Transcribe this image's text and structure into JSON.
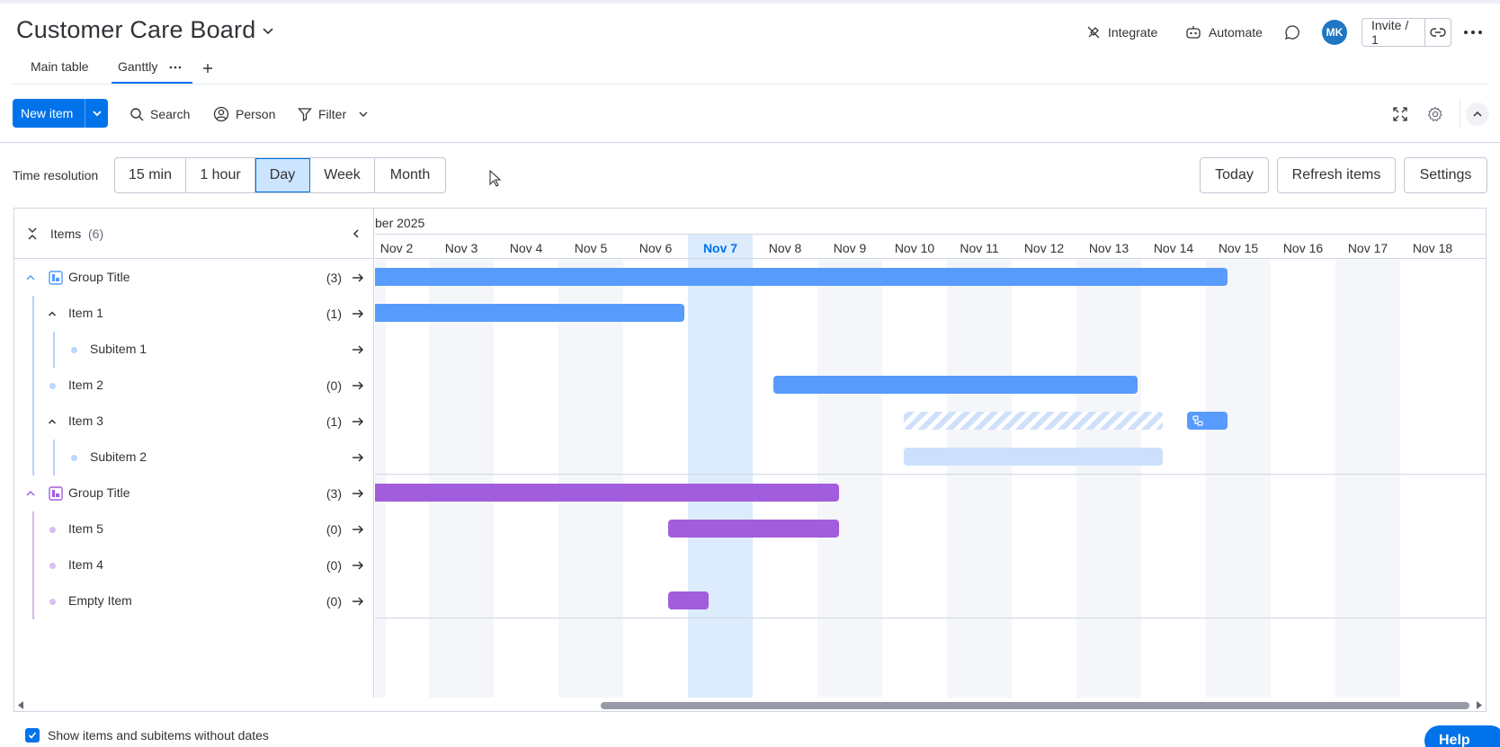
{
  "board": {
    "title": "Customer Care Board"
  },
  "header": {
    "integrate": "Integrate",
    "automate": "Automate",
    "avatar": "MK",
    "invite": "Invite / 1"
  },
  "tabs": [
    {
      "label": "Main table",
      "active": false
    },
    {
      "label": "Ganttly",
      "active": true
    }
  ],
  "toolbar": {
    "new_item": "New item",
    "search": "Search",
    "person": "Person",
    "filter": "Filter"
  },
  "time_resolution": {
    "label": "Time resolution",
    "options": [
      "15 min",
      "1 hour",
      "Day",
      "Week",
      "Month"
    ],
    "selected": "Day"
  },
  "actions": {
    "today": "Today",
    "refresh": "Refresh items",
    "settings": "Settings"
  },
  "items_header": {
    "label": "Items",
    "count": "(6)"
  },
  "rows": [
    {
      "label": "Group Title",
      "count": "(3)",
      "type": "group",
      "color": "#579bfc"
    },
    {
      "label": "Item 1",
      "count": "(1)",
      "type": "parent",
      "color": "#579bfc"
    },
    {
      "label": "Subitem 1",
      "count": "",
      "type": "sub",
      "color": "#579bfc"
    },
    {
      "label": "Item 2",
      "count": "(0)",
      "type": "item",
      "color": "#579bfc"
    },
    {
      "label": "Item 3",
      "count": "(1)",
      "type": "parent",
      "color": "#579bfc"
    },
    {
      "label": "Subitem 2",
      "count": "",
      "type": "sub",
      "color": "#579bfc"
    },
    {
      "label": "Group Title",
      "count": "(3)",
      "type": "group",
      "color": "#a25ddc"
    },
    {
      "label": "Item 5",
      "count": "(0)",
      "type": "item",
      "color": "#a25ddc"
    },
    {
      "label": "Item 4",
      "count": "(0)",
      "type": "item",
      "color": "#a25ddc"
    },
    {
      "label": "Empty Item",
      "count": "(0)",
      "type": "item",
      "color": "#a25ddc"
    }
  ],
  "timeline": {
    "month_label": "ber 2025",
    "days": [
      "Nov 2",
      "Nov 3",
      "Nov 4",
      "Nov 5",
      "Nov 6",
      "Nov 7",
      "Nov 8",
      "Nov 9",
      "Nov 10",
      "Nov 11",
      "Nov 12",
      "Nov 13",
      "Nov 14",
      "Nov 15",
      "Nov 16",
      "Nov 17",
      "Nov 18"
    ],
    "today": "Nov 7"
  },
  "footer": {
    "show_without_dates": "Show items and subitems without dates",
    "checked": true
  },
  "help": "Help"
}
